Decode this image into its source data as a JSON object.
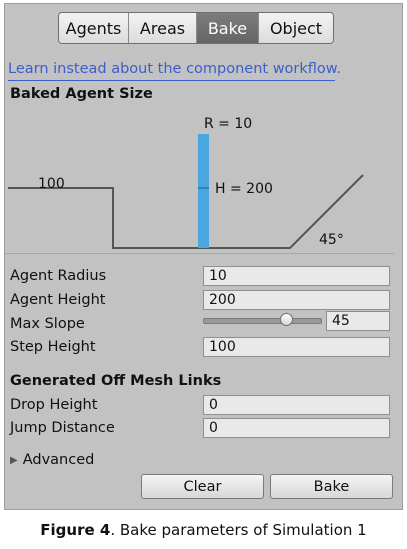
{
  "tabs": [
    "Agents",
    "Areas",
    "Bake",
    "Object"
  ],
  "active_tab": "Bake",
  "link_text": "Learn instead about the component workflow.",
  "baked_agent_size": {
    "title": "Baked Agent Size",
    "radius_label": "R = 10",
    "height_label": "H = 200",
    "step_label": "100",
    "slope_label": "45°"
  },
  "fields": {
    "agent_radius": {
      "label": "Agent Radius",
      "value": "10"
    },
    "agent_height": {
      "label": "Agent Height",
      "value": "200"
    },
    "max_slope": {
      "label": "Max Slope",
      "value": "45",
      "slider_fraction": 0.75
    },
    "step_height": {
      "label": "Step Height",
      "value": "100"
    }
  },
  "off_mesh_links": {
    "title": "Generated Off Mesh Links",
    "drop_height": {
      "label": "Drop Height",
      "value": "0"
    },
    "jump_distance": {
      "label": "Jump Distance",
      "value": "0"
    }
  },
  "advanced_label": "Advanced",
  "buttons": {
    "clear": "Clear",
    "bake": "Bake"
  },
  "caption": {
    "figure": "Figure 4",
    "text": ". Bake parameters of Simulation 1"
  },
  "colors": {
    "agent_cylinder": "#4aa6de",
    "link": "#3a5fcd",
    "active_tab": "#6e6e6e"
  }
}
